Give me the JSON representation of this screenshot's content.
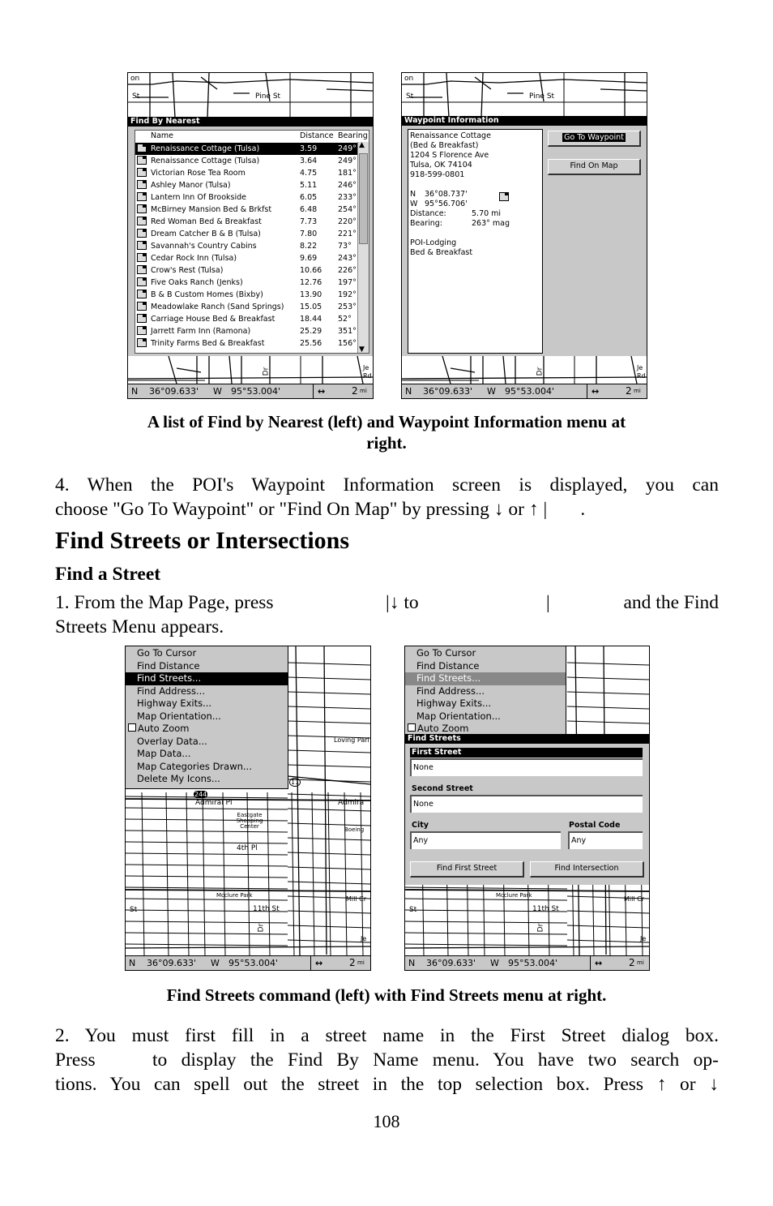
{
  "screens": {
    "nearest": {
      "title": "Find By Nearest",
      "columns": [
        "Name",
        "Distance",
        "Bearing"
      ],
      "rows": [
        [
          "Renaissance Cottage (Tulsa)",
          "3.59",
          "249°"
        ],
        [
          "Renaissance Cottage (Tulsa)",
          "3.64",
          "249°"
        ],
        [
          "Victorian Rose Tea Room",
          "4.75",
          "181°"
        ],
        [
          "Ashley Manor (Tulsa)",
          "5.11",
          "246°"
        ],
        [
          "Lantern Inn Of Brookside",
          "6.05",
          "233°"
        ],
        [
          "McBirney Mansion Bed & Brkfst",
          "6.48",
          "254°"
        ],
        [
          "Red Woman Bed & Breakfast",
          "7.73",
          "220°"
        ],
        [
          "Dream Catcher B & B (Tulsa)",
          "7.80",
          "221°"
        ],
        [
          "Savannah's Country Cabins",
          "8.22",
          "73°"
        ],
        [
          "Cedar Rock Inn (Tulsa)",
          "9.69",
          "243°"
        ],
        [
          "Crow's Rest (Tulsa)",
          "10.66",
          "226°"
        ],
        [
          "Five Oaks Ranch (Jenks)",
          "12.76",
          "197°"
        ],
        [
          "B & B Custom Homes (Bixby)",
          "13.90",
          "192°"
        ],
        [
          "Meadowlake Ranch (Sand Springs)",
          "15.05",
          "253°"
        ],
        [
          "Carriage House Bed & Breakfast",
          "18.44",
          "52°"
        ],
        [
          "Jarrett Farm Inn (Ramona)",
          "25.29",
          "351°"
        ],
        [
          "Trinity Farms Bed & Breakfast",
          "25.56",
          "156°"
        ]
      ],
      "selected_index": 0,
      "scroll_up": "▲",
      "scroll_down": "▼"
    },
    "waypoint": {
      "title": "Waypoint Information",
      "lines": [
        "Renaissance Cottage",
        "(Bed & Breakfast)",
        "1204 S Florence Ave",
        "Tulsa, OK 74104",
        "918-599-0801"
      ],
      "lat_label": "N",
      "lat": "36°08.737'",
      "lon_label": "W",
      "lon": "95°56.706'",
      "distance_label": "Distance:",
      "distance": "5.70 mi",
      "bearing_label": "Bearing:",
      "bearing": "263° mag",
      "category": "POI-Lodging",
      "subcategory": "Bed & Breakfast",
      "go_button": "Go To Waypoint",
      "find_button": "Find On Map"
    },
    "map_menu": {
      "items": [
        "Go To Cursor",
        "Find Distance",
        "Find Streets...",
        "Find Address...",
        "Highway Exits...",
        "Map Orientation...",
        "Auto Zoom",
        "Overlay Data...",
        "Map Data...",
        "Map Categories Drawn...",
        "Delete My Icons..."
      ],
      "selected_index": 2,
      "checkbox_item": "Auto Zoom",
      "auto_zoom_checked": false
    },
    "find_streets": {
      "title": "Find Streets",
      "first_street_label": "First Street",
      "first_street_value": "None",
      "second_street_label": "Second Street",
      "second_street_value": "None",
      "city_label": "City",
      "city_value": "Any",
      "postal_label": "Postal Code",
      "postal_value": "Any",
      "find_first_button": "Find First Street",
      "find_intersection_button": "Find Intersection"
    },
    "status": {
      "lat_label": "N",
      "lat": "36°09.633'",
      "lon_label": "W",
      "lon": "95°53.004'",
      "zoom_icon": "↔",
      "zoom": "2",
      "unit": "mi"
    },
    "map_labels": {
      "pine": "Pine St",
      "st": "St",
      "on": "on",
      "dr": "Dr",
      "je": "Je",
      "rd": "Rd",
      "loving": "Loving Parl",
      "admiral": "Admiral Pl",
      "admira": "Admira",
      "eastgate": "Eastgate Shopping Center",
      "fourth": "4th Pl",
      "mcclure": "Mcclure Park",
      "eleventh": "11th St",
      "mill": "Mill Cr",
      "hwy11": "11",
      "hwy244": "244",
      "boeing": "Boeing"
    }
  },
  "doc": {
    "caption1_l1": "A list of Find by Nearest (left) and Waypoint Information menu at",
    "caption1_l2": "right.",
    "p4_l1": "4. When the POI's Waypoint Information screen is displayed, you can",
    "p4_l2": "choose \"Go To Waypoint\" or \"Find On Map\" by pressing ↓ or ↑ |       .",
    "heading": "Find Streets or Intersections",
    "subheading": "Find a Street",
    "p1_l1a": "1. From the Map Page, press",
    "p1_l1b": "|↓ to",
    "p1_l1c": "|",
    "p1_l1d": "and the Find",
    "p1_l2": "Streets Menu appears.",
    "caption2": "Find Streets command (left) with Find Streets menu at right.",
    "p2_l1": "2. You must first fill in a street name in the First Street dialog box.",
    "p2_l2a": "Press",
    "p2_l2b": "to display the Find By Name menu. You have two search op-",
    "p2_l3": "tions. You can spell out the street in the top selection box. Press ↑ or ↓",
    "page_number": "108"
  }
}
